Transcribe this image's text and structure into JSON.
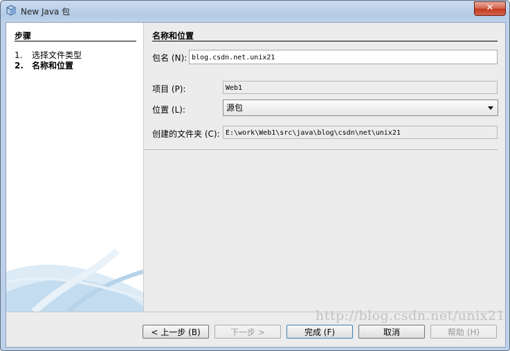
{
  "window": {
    "title": "New Java 包",
    "close_label": "✕"
  },
  "steps": {
    "title": "步骤",
    "items": [
      {
        "num": "1.",
        "label": "选择文件类型"
      },
      {
        "num": "2.",
        "label": "名称和位置"
      }
    ]
  },
  "panel": {
    "title": "名称和位置",
    "package_label": "包名 (N):",
    "package_value": "blog.csdn.net.unix21",
    "project_label": "项目 (P):",
    "project_value": "Web1",
    "location_label": "位置 (L):",
    "location_value": "源包",
    "folder_label": "创建的文件夹 (C):",
    "folder_value": "E:\\work\\Web1\\src\\java\\blog\\csdn\\net\\unix21"
  },
  "buttons": {
    "back": "< 上一步 (B)",
    "next": "下一步 >",
    "finish": "完成 (F)",
    "cancel": "取消",
    "help": "帮助 (H)"
  },
  "watermark": "http://blog.csdn.net/unix21",
  "colors": {
    "title_bar": "#bdd1ea",
    "close_button": "#c2391e",
    "dialog_bg": "#ececec",
    "default_button_border": "#3c7fb1"
  },
  "icons": [
    "java-package-icon",
    "close-icon",
    "dropdown-arrow-icon"
  ]
}
